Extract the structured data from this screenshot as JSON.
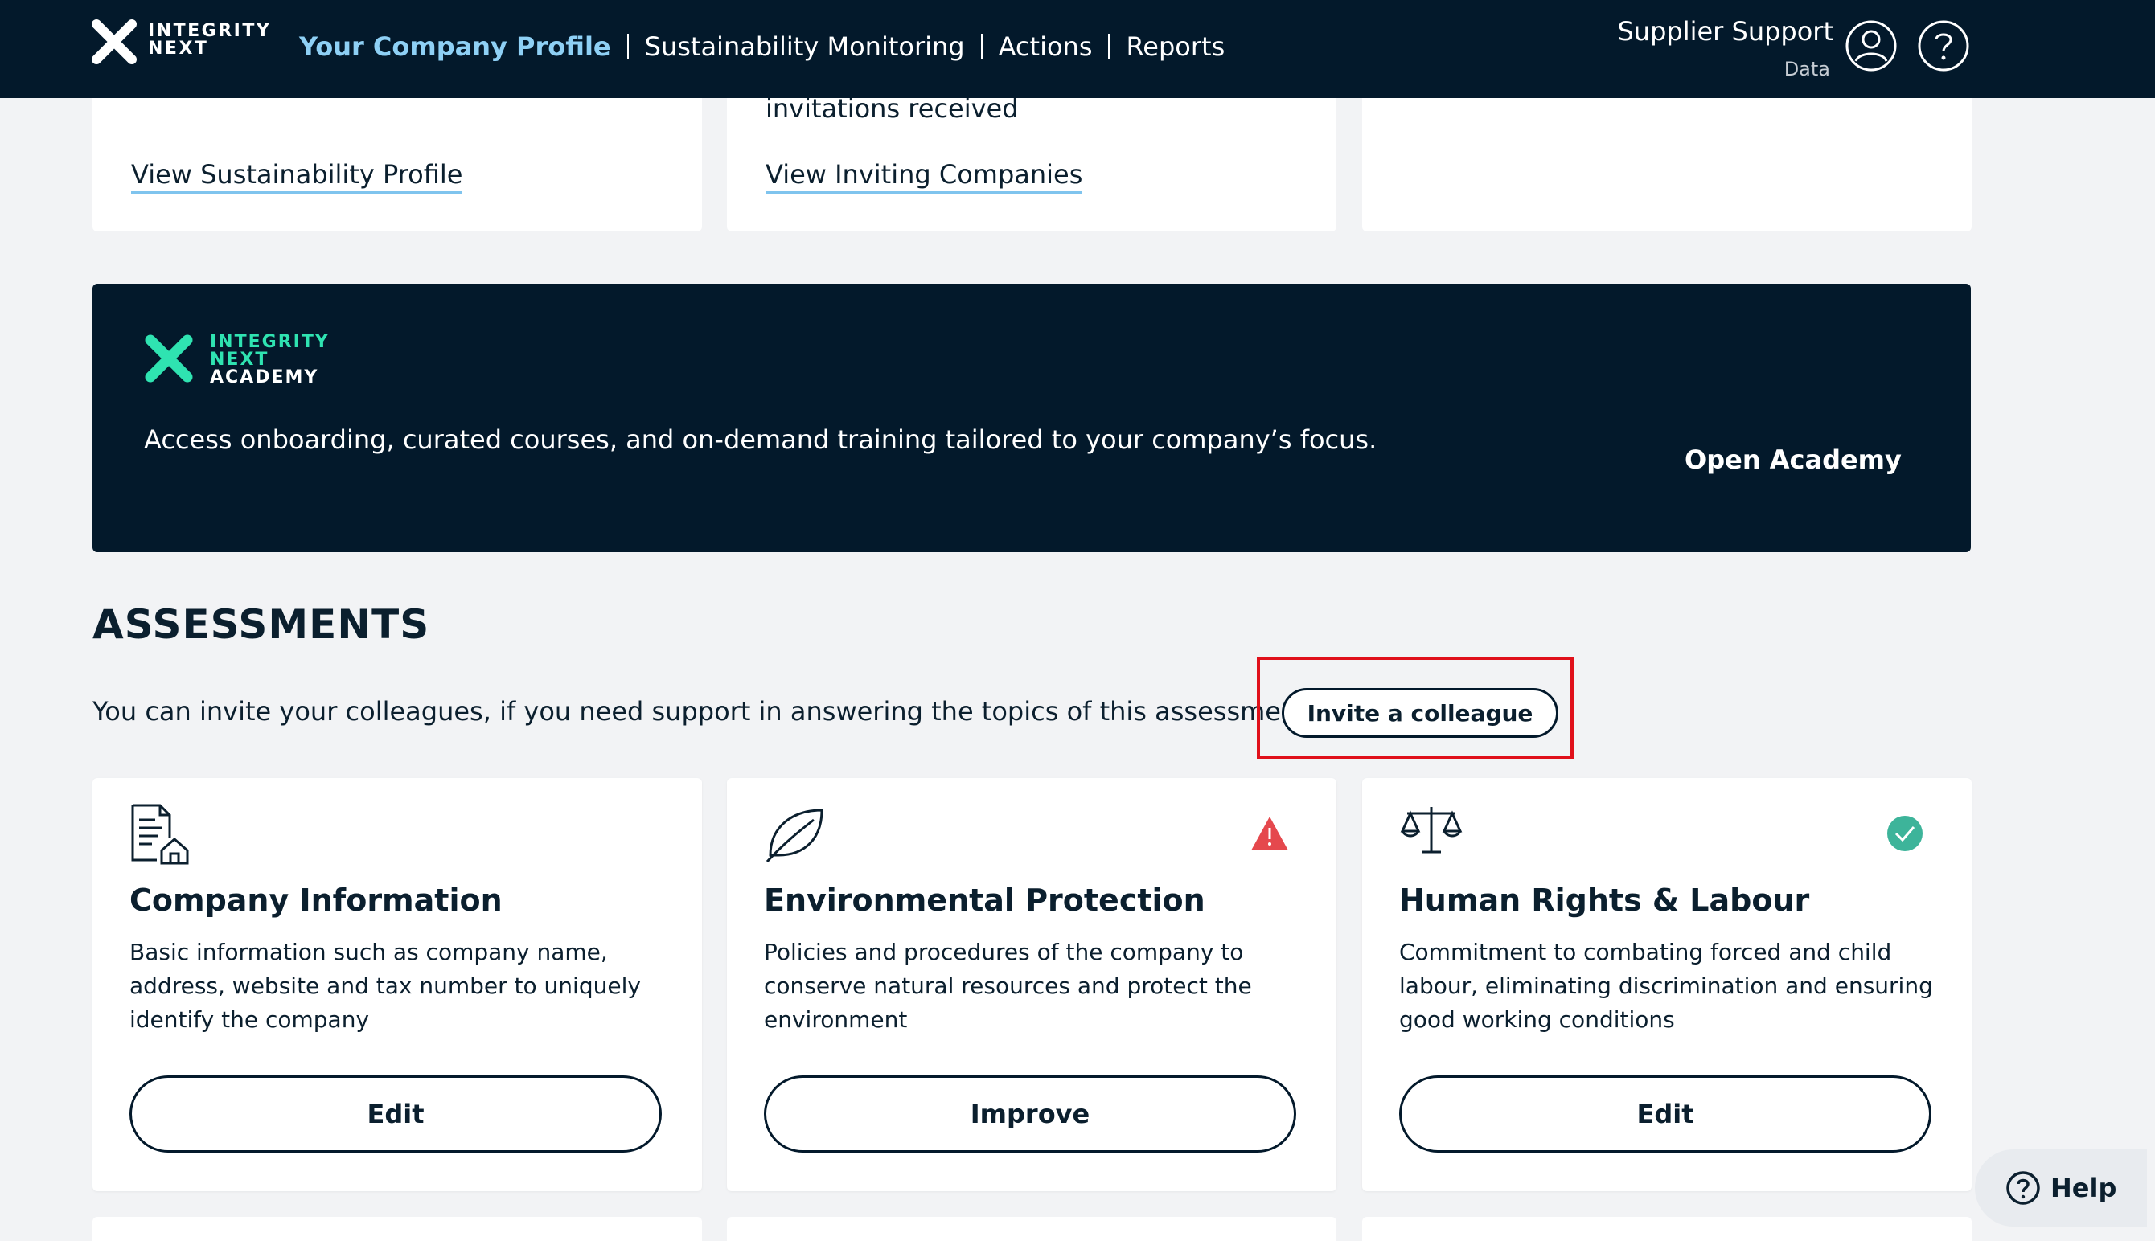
{
  "header": {
    "logo_text": [
      "INTEGRITY",
      "NEXT"
    ],
    "nav": [
      {
        "label": "Your Company Profile",
        "active": true
      },
      {
        "label": "Sustainability Monitoring",
        "active": false
      },
      {
        "label": "Actions",
        "active": false
      },
      {
        "label": "Reports",
        "active": false
      }
    ],
    "support_name": "Supplier Support",
    "support_sub": "Data",
    "user_icon": "user-icon",
    "help_icon": "help-icon"
  },
  "top_cards": [
    {
      "link": "View Sustainability Profile"
    },
    {
      "text": "invitations received",
      "link": "View Inviting Companies"
    },
    {}
  ],
  "academy": {
    "logo_text": [
      "INTEGRITY",
      "NEXT",
      "ACADEMY"
    ],
    "description": "Access onboarding, curated courses, and on-demand training tailored to your company’s focus.",
    "open_label": "Open Academy"
  },
  "assessments": {
    "title": "ASSESSMENTS",
    "invite_text": "You can invite your colleagues, if you need support in answering the topics of this assessment:",
    "invite_button": "Invite a colleague",
    "cards": [
      {
        "icon": "document-house-icon",
        "title": "Company Information",
        "description": "Basic information such as company name, address, website and tax number to uniquely identify the company",
        "button": "Edit",
        "status": ""
      },
      {
        "icon": "leaf-icon",
        "title": "Environmental Protection",
        "description": "Policies and procedures of the company to conserve natural resources and protect the environment",
        "button": "Improve",
        "status": "warning"
      },
      {
        "icon": "scales-icon",
        "title": "Human Rights & Labour",
        "description": "Commitment to combating forced and child labour, eliminating discrimination and ensuring good working conditions",
        "button": "Edit",
        "status": "complete"
      }
    ]
  },
  "help_widget": {
    "label": "Help"
  },
  "colors": {
    "navy": "#03192b",
    "active_nav": "#8ed0f5",
    "academy_green": "#2fe3b1",
    "warning": "#e5484d",
    "success": "#3db49a",
    "highlight": "#e0101a"
  }
}
